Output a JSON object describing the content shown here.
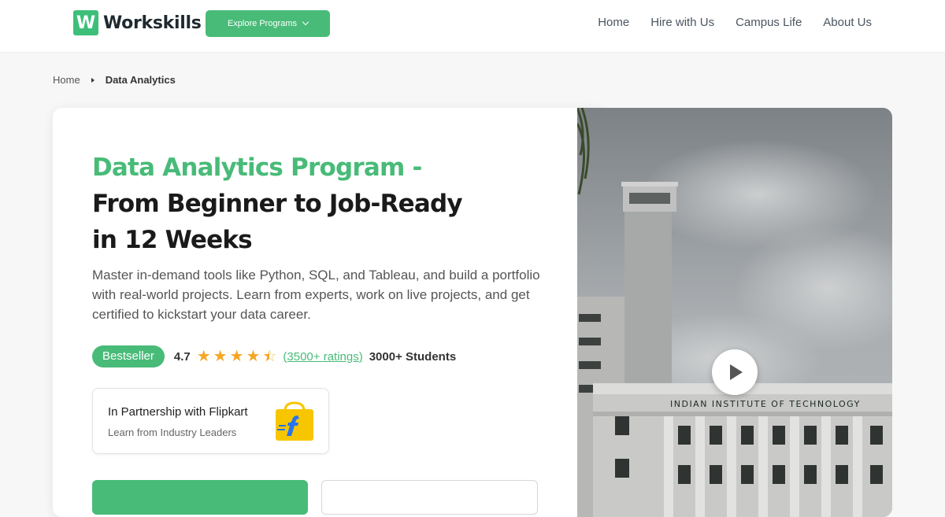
{
  "header": {
    "logo_mark": "W",
    "logo_text": "Workskills",
    "explore_label": "Explore Programs",
    "nav": [
      "Home",
      "Hire with Us",
      "Campus Life",
      "About Us"
    ]
  },
  "breadcrumb": {
    "home": "Home",
    "current": "Data Analytics"
  },
  "hero": {
    "title_accent": "Data Analytics Program -",
    "title_line1": "From Beginner to Job-Ready",
    "title_line2": "in 12 Weeks",
    "description": "Master in-demand tools like Python, SQL, and Tableau, and build a portfolio with real-world projects. Learn from experts, work on live projects, and get certified to kickstart your data career.",
    "badge": "Bestseller",
    "rating": "4.7",
    "rating_stars": 4.5,
    "ratings_link": "(3500+ ratings)",
    "students": "3000+ Students"
  },
  "partner": {
    "title": "In Partnership with Flipkart",
    "subtitle": "Learn from Industry Leaders"
  },
  "video": {
    "building_sign": "INDIAN INSTITUTE OF TECHNOLOGY"
  },
  "colors": {
    "accent": "#48bb78",
    "star": "#f5a623"
  },
  "icons": {
    "play": "play-icon",
    "chevron": "chevron-down-icon",
    "breadcrumb_sep": "caret-right-icon",
    "flipkart": "flipkart-logo-icon"
  }
}
